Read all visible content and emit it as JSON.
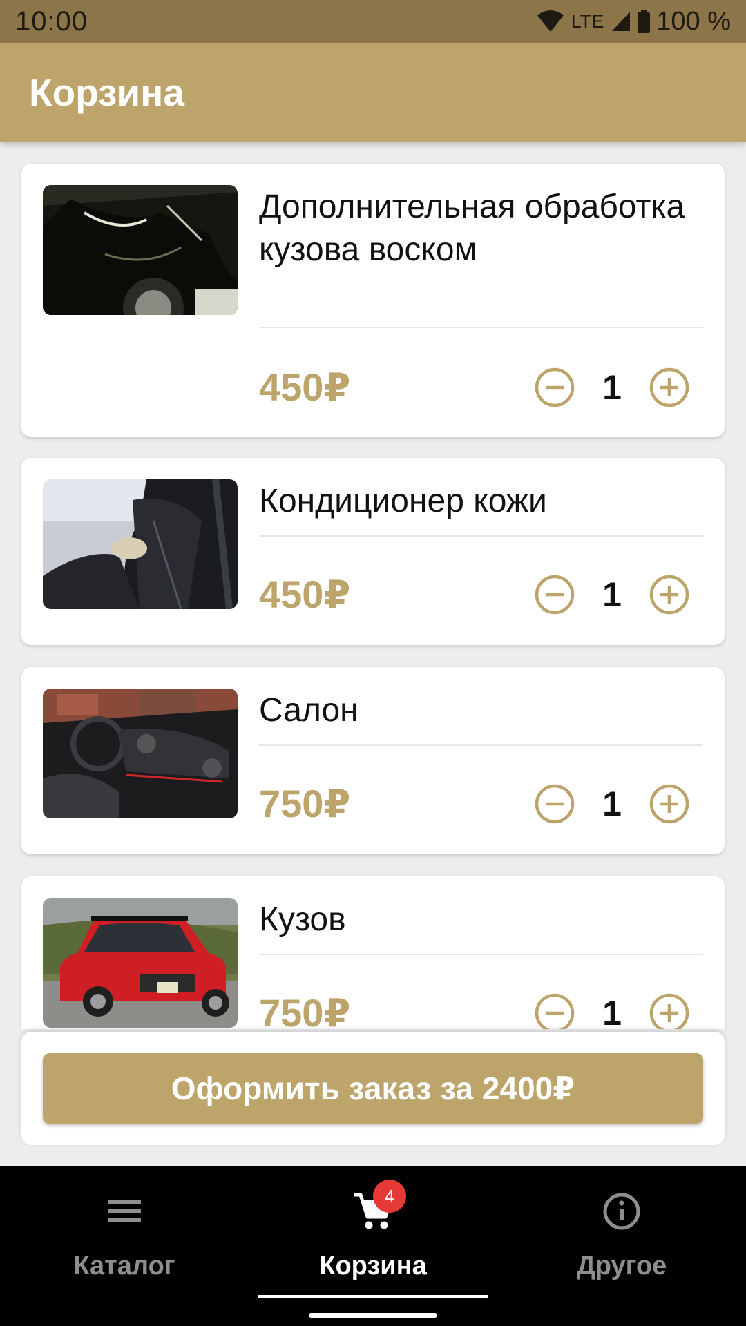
{
  "status_bar": {
    "time": "10:00",
    "network": "LTE",
    "battery": "100 %"
  },
  "app_bar": {
    "title": "Корзина"
  },
  "cart": {
    "items": [
      {
        "title": "Дополнительная обработка кузова воском",
        "price": "450₽",
        "quantity": "1",
        "image_icon": "car-wax-photo"
      },
      {
        "title": "Кондиционер кожи",
        "price": "450₽",
        "quantity": "1",
        "image_icon": "leather-seat-photo"
      },
      {
        "title": "Салон",
        "price": "750₽",
        "quantity": "1",
        "image_icon": "car-interior-photo"
      },
      {
        "title": "Кузов",
        "price": "750₽",
        "quantity": "1",
        "image_icon": "red-car-photo"
      }
    ]
  },
  "checkout": {
    "label": "Оформить заказ за 2400₽"
  },
  "bottom_nav": {
    "items": [
      {
        "label": "Каталог",
        "icon": "menu-icon",
        "active": false
      },
      {
        "label": "Корзина",
        "icon": "cart-icon",
        "active": true,
        "badge": "4"
      },
      {
        "label": "Другое",
        "icon": "info-icon",
        "active": false
      }
    ]
  },
  "colors": {
    "accent": "#BCA46A",
    "status_bar": "#8C7548",
    "badge": "#E53935"
  }
}
